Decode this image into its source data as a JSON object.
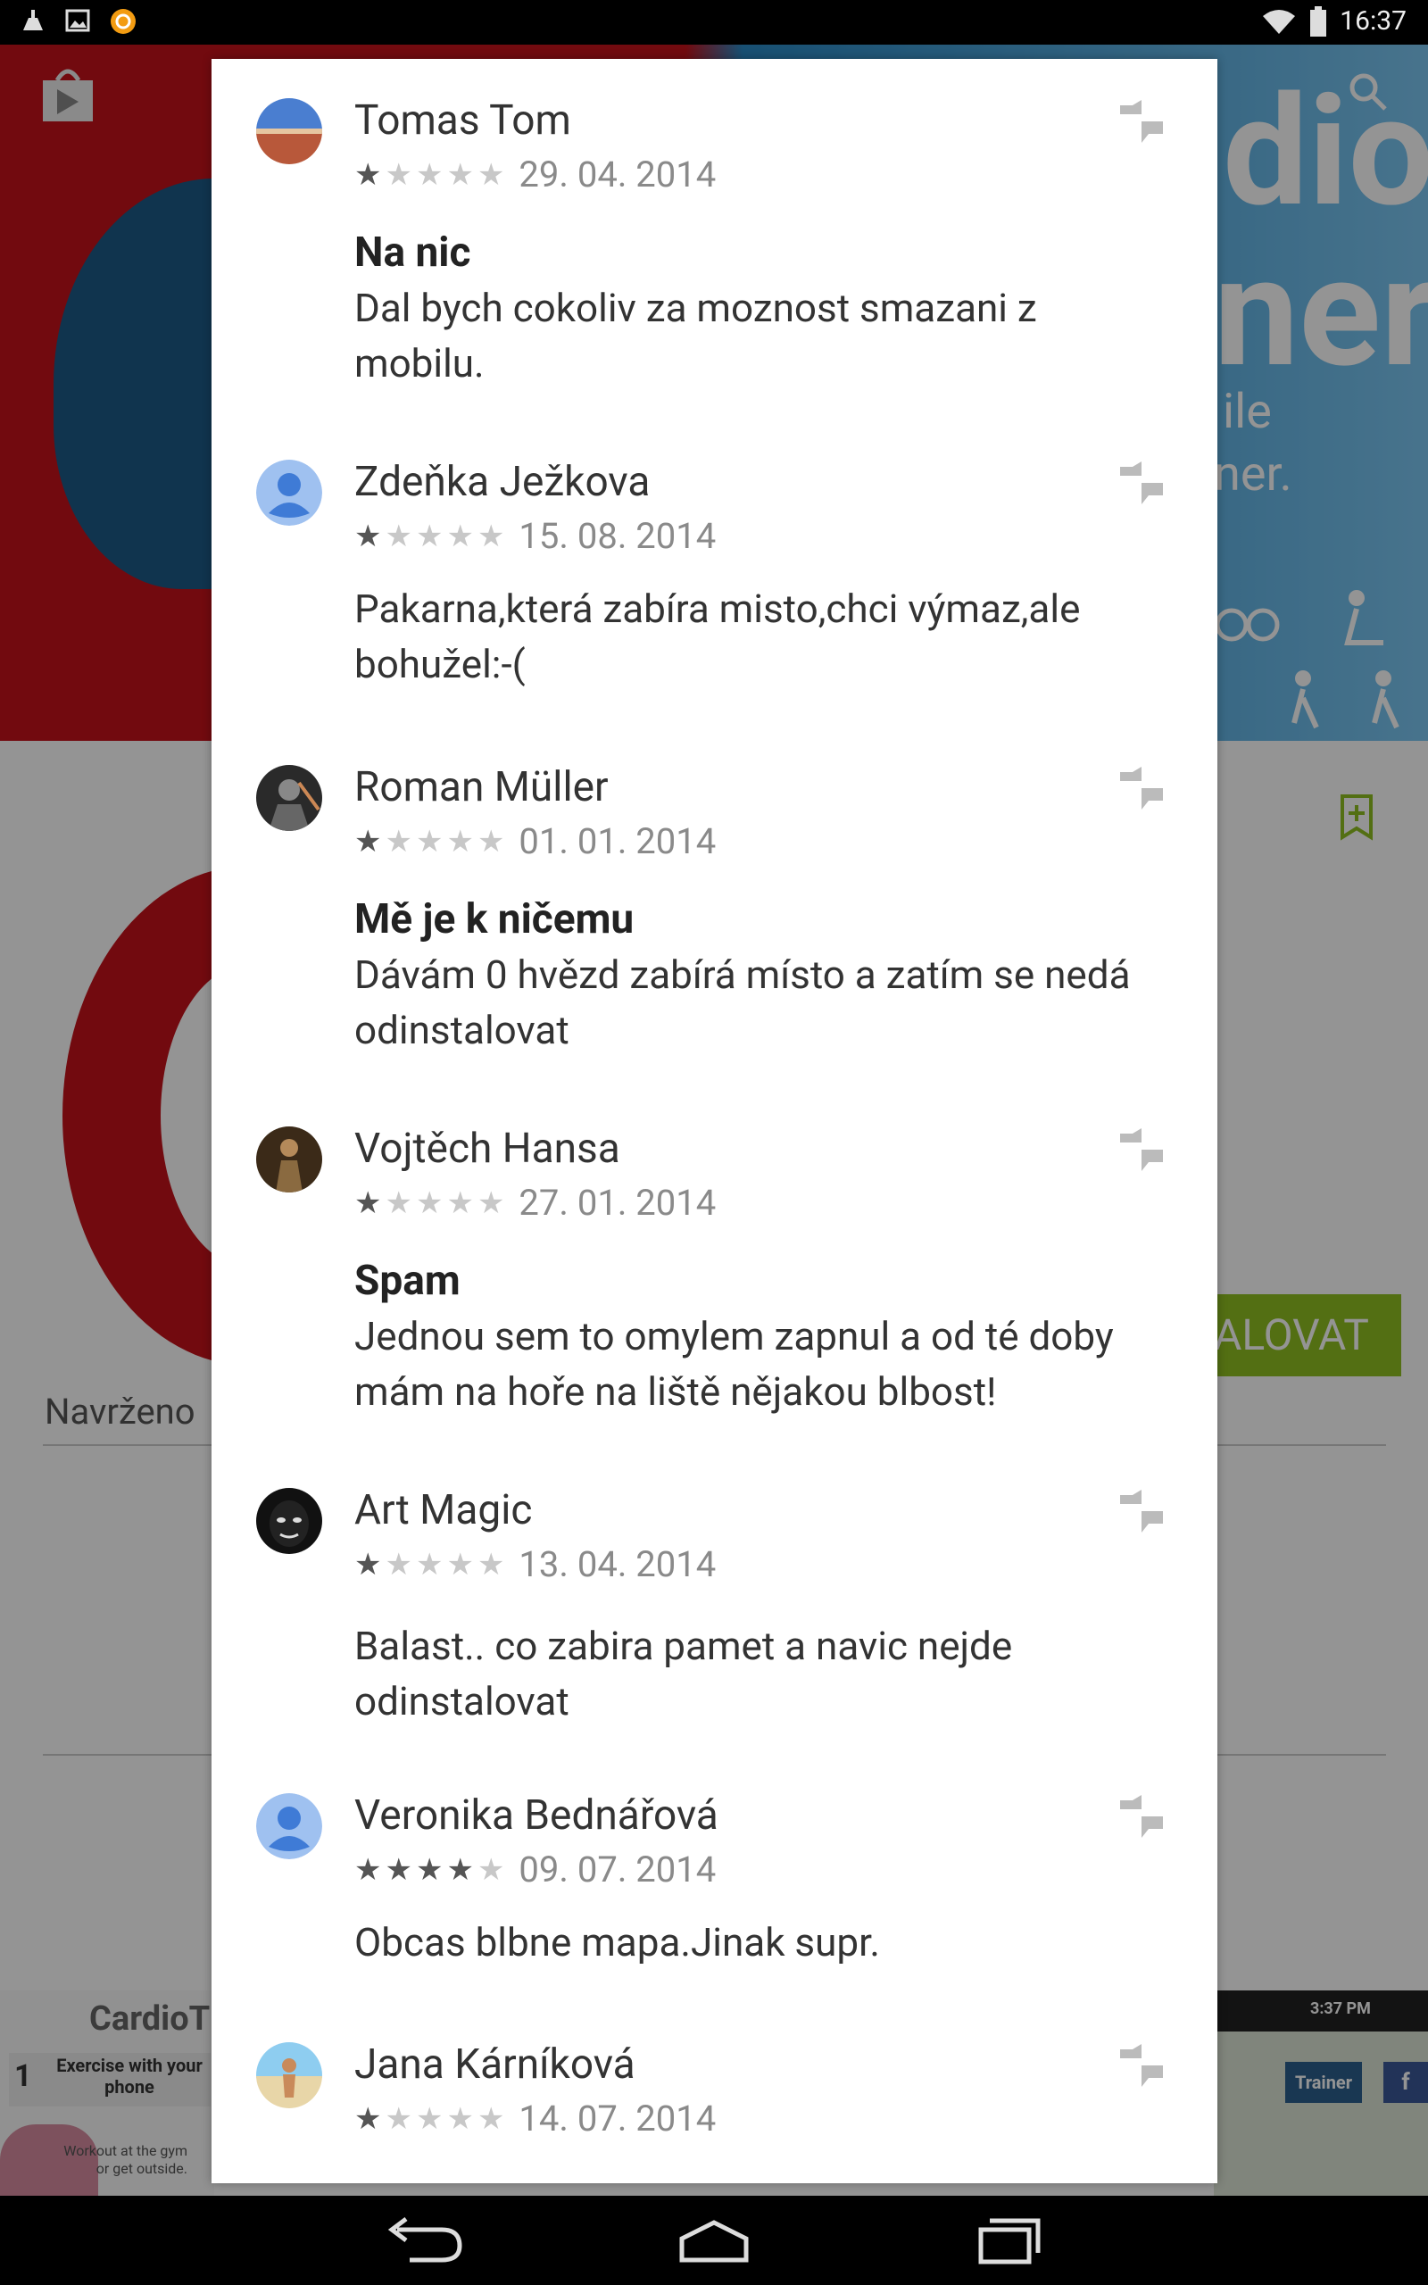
{
  "status_bar": {
    "time": "16:37",
    "left_icons": [
      "cleaner-icon",
      "image-icon",
      "avast-icon"
    ],
    "right_icons": [
      "wifi-icon",
      "battery-icon"
    ]
  },
  "background_app": {
    "hero_title_line1": "dio",
    "hero_title_line2": "ner",
    "hero_subtitle_line1": "ile",
    "hero_subtitle_line2": "ner.",
    "install_label": "ALOVAT",
    "suggested_label": "Navrženo",
    "screenshot1": {
      "brand": "CardioT",
      "step_number": "1",
      "step_caption": "Exercise with your phone",
      "text": "Workout at the gym or get outside."
    },
    "screenshot2": {
      "time": "3:37 PM",
      "trainer_label": "Trainer",
      "facebook_label": "f"
    },
    "accent_color": "#8fbf21"
  },
  "reviews": [
    {
      "author": "Tomas Tom",
      "rating": 1,
      "date": "29. 04. 2014",
      "title": "Na nic",
      "body": "Dal bych cokoliv za moznost smazani z mobilu.",
      "avatar": "landscape"
    },
    {
      "author": "Zdeňka Ježkova",
      "rating": 1,
      "date": "15. 08. 2014",
      "title": "",
      "body": "Pakarna,která zabíra misto,chci výmaz,ale bohužel:-(",
      "avatar": "default"
    },
    {
      "author": "Roman Müller",
      "rating": 1,
      "date": "01. 01. 2014",
      "title": "Mě je k ničemu",
      "body": "Dávám 0 hvězd zabírá místo a zatím se nedá odinstalovat",
      "avatar": "soldier"
    },
    {
      "author": "Vojtěch Hansa",
      "rating": 1,
      "date": "27. 01. 2014",
      "title": "Spam",
      "body": "Jednou sem to omylem zapnul a od té doby mám na hoře na liště nějakou blbost!",
      "avatar": "figure"
    },
    {
      "author": "Art Magic",
      "rating": 1,
      "date": "13. 04. 2014",
      "title": "",
      "body": "Balast.. co zabira pamet a navic nejde odinstalovat",
      "avatar": "face"
    },
    {
      "author": "Veronika Bednářová",
      "rating": 4,
      "date": "09. 07. 2014",
      "title": "",
      "body": "Obcas blbne mapa.Jinak supr.",
      "avatar": "default"
    },
    {
      "author": "Jana Kárníková",
      "rating": 1,
      "date": "14. 07. 2014",
      "title": "",
      "body": "",
      "avatar": "beach"
    }
  ],
  "nav_bar": {
    "buttons": [
      "back-icon",
      "home-icon",
      "recents-icon"
    ]
  }
}
